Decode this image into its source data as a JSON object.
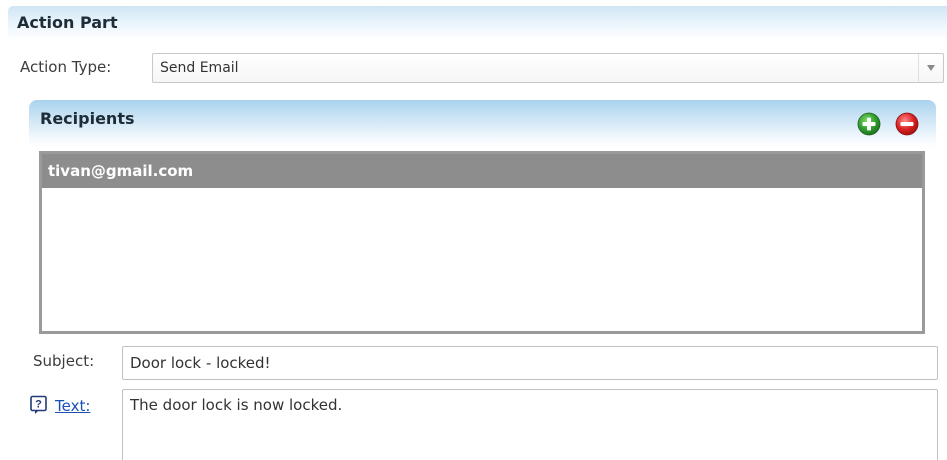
{
  "action_part": {
    "title": "Action Part",
    "action_type": {
      "label": "Action Type:",
      "selected": "Send Email"
    }
  },
  "recipients": {
    "title": "Recipients",
    "add_icon": "add-circle-icon",
    "remove_icon": "remove-circle-icon",
    "items": [
      {
        "email": "tivan@gmail.com",
        "selected": true
      }
    ]
  },
  "subject": {
    "label": "Subject:",
    "value": "Door lock - locked!"
  },
  "text": {
    "help_icon": "help-question-icon",
    "link_label": "Text:",
    "value": "The door lock is now locked."
  },
  "colors": {
    "header_gradient_top": "#cfe6f5",
    "panel_gradient_top": "#a9d2ee",
    "selected_row": "#8d8d8d",
    "add_green": "#2e9a2e",
    "remove_red": "#d62020",
    "link_blue": "#1a4fb5"
  }
}
